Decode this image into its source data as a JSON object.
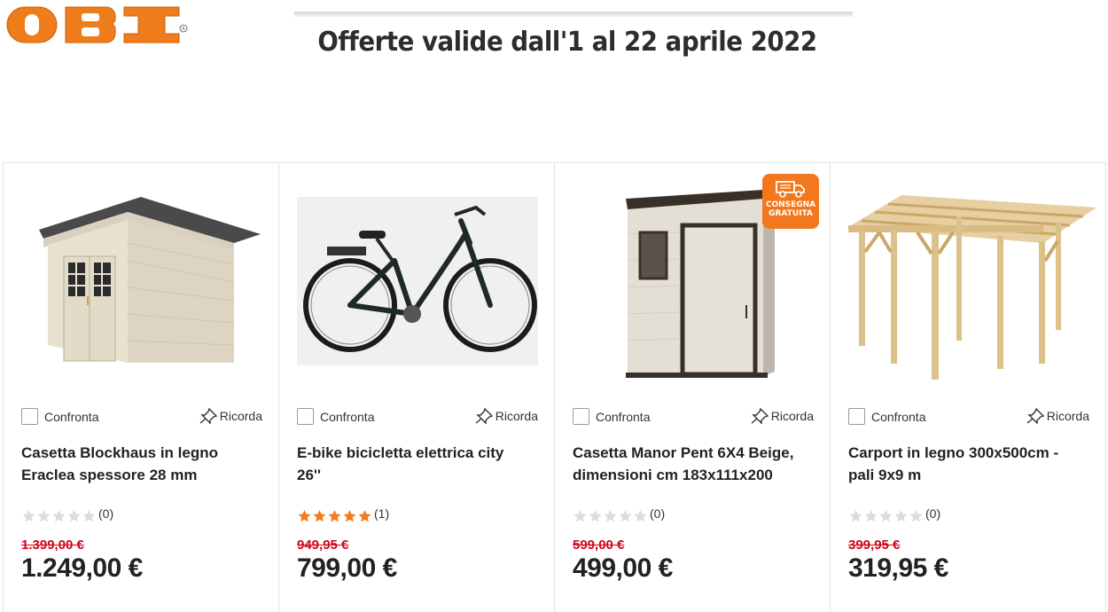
{
  "brand": {
    "logo_text": "OBI",
    "color": "#f07d1b"
  },
  "headline": "Offerte valide dall'1 al 22 aprile 2022",
  "labels": {
    "compare": "Confronta",
    "remember": "Ricorda"
  },
  "products": [
    {
      "title": "Casetta Blockhaus in legno Eraclea spessore 28 mm",
      "rating": 0,
      "rating_count": "(0)",
      "old_price": "1.399,00 €",
      "price": "1.249,00 €"
    },
    {
      "title": "E-bike bicicletta elettrica city 26''",
      "rating": 5,
      "rating_count": "(1)",
      "old_price": "949,95 €",
      "price": "799,00 €"
    },
    {
      "title": "Casetta Manor Pent 6X4 Beige, dimensioni cm 183x111x200",
      "rating": 0,
      "rating_count": "(0)",
      "old_price": "599,00 €",
      "price": "499,00 €",
      "badge": [
        "CONSEGNA",
        "GRATUITA"
      ]
    },
    {
      "title": "Carport in legno 300x500cm - pali 9x9 m",
      "rating": 0,
      "rating_count": "(0)",
      "old_price": "399,95 €",
      "price": "319,95 €"
    }
  ],
  "colors": {
    "star_filled": "#f47c20",
    "star_empty": "#dcdcdc",
    "old_price": "#d0021b",
    "badge": "#f3781d"
  }
}
